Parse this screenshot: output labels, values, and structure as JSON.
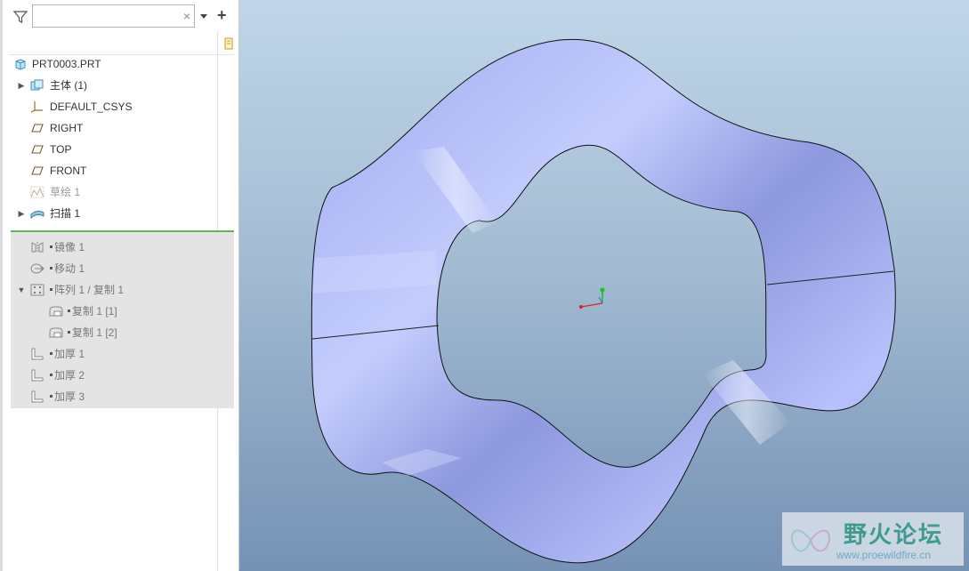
{
  "search": {
    "value": "",
    "placeholder": ""
  },
  "tree": {
    "root": {
      "label": "PRT0003.PRT"
    },
    "items": [
      {
        "label": "主体 (1)",
        "icon": "body-icon",
        "expandable": true
      },
      {
        "label": "DEFAULT_CSYS",
        "icon": "csys-icon"
      },
      {
        "label": "RIGHT",
        "icon": "datum-plane-icon"
      },
      {
        "label": "TOP",
        "icon": "datum-plane-icon"
      },
      {
        "label": "FRONT",
        "icon": "datum-plane-icon"
      },
      {
        "label": "草绘 1",
        "icon": "sketch-icon",
        "state": "hidden"
      },
      {
        "label": "扫描 1",
        "icon": "sweep-icon",
        "expandable": true
      }
    ],
    "suppressed": [
      {
        "label": "镜像 1",
        "icon": "mirror-icon"
      },
      {
        "label": "移动 1",
        "icon": "move-icon"
      },
      {
        "label": "阵列 1 / 复制 1",
        "icon": "pattern-icon",
        "expanded": true
      },
      {
        "label": "复制 1 [1]",
        "icon": "copy-icon"
      },
      {
        "label": "复制 1 [2]",
        "icon": "copy-icon"
      },
      {
        "label": "加厚 1",
        "icon": "thicken-icon"
      },
      {
        "label": "加厚 2",
        "icon": "thicken-icon"
      },
      {
        "label": "加厚 3",
        "icon": "thicken-icon"
      }
    ]
  },
  "watermark": {
    "title": "野火论坛",
    "url": "www.proewildfire.cn"
  },
  "colors": {
    "surface": "#a9b5f5",
    "insert_line": "#5cb85c",
    "suppressed_bg": "#e4e4e4"
  }
}
